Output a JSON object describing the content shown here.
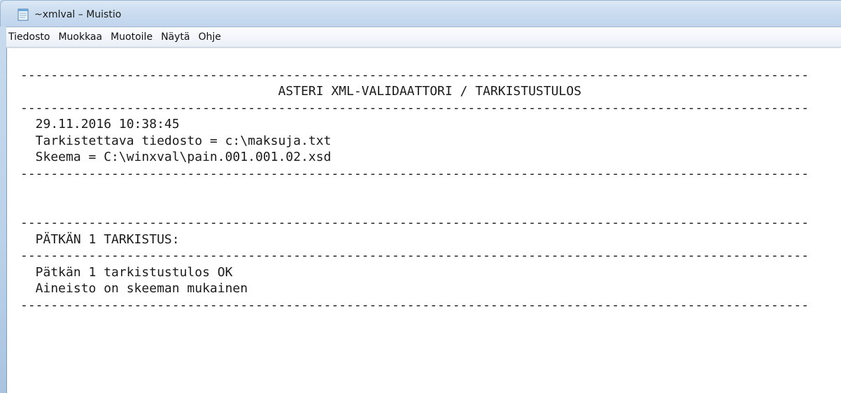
{
  "window": {
    "title": "~xmlval – Muistio"
  },
  "menu": {
    "items": [
      "Tiedosto",
      "Muokkaa",
      "Muotoile",
      "Näytä",
      "Ohje"
    ]
  },
  "document": {
    "text": "\n--------------------------------------------------------------------------------------------------------\n                                  ASTERI XML-VALIDAATTORI / TARKISTUSTULOS\n--------------------------------------------------------------------------------------------------------\n  29.11.2016 10:38:45\n  Tarkistettava tiedosto = c:\\maksuja.txt\n  Skeema = C:\\winxval\\pain.001.001.02.xsd\n--------------------------------------------------------------------------------------------------------\n\n\n--------------------------------------------------------------------------------------------------------\n  PÄTKÄN 1 TARKISTUS:\n--------------------------------------------------------------------------------------------------------\n  Pätkän 1 tarkistustulos OK\n  Aineisto on skeeman mukainen\n--------------------------------------------------------------------------------------------------------"
  },
  "icons": {
    "app_icon": "notepad-icon"
  },
  "colors": {
    "titlebar": "#cadcef",
    "menubar": "#f2f5fa",
    "editor_background": "#ffffff",
    "text": "#1b1b1b"
  }
}
